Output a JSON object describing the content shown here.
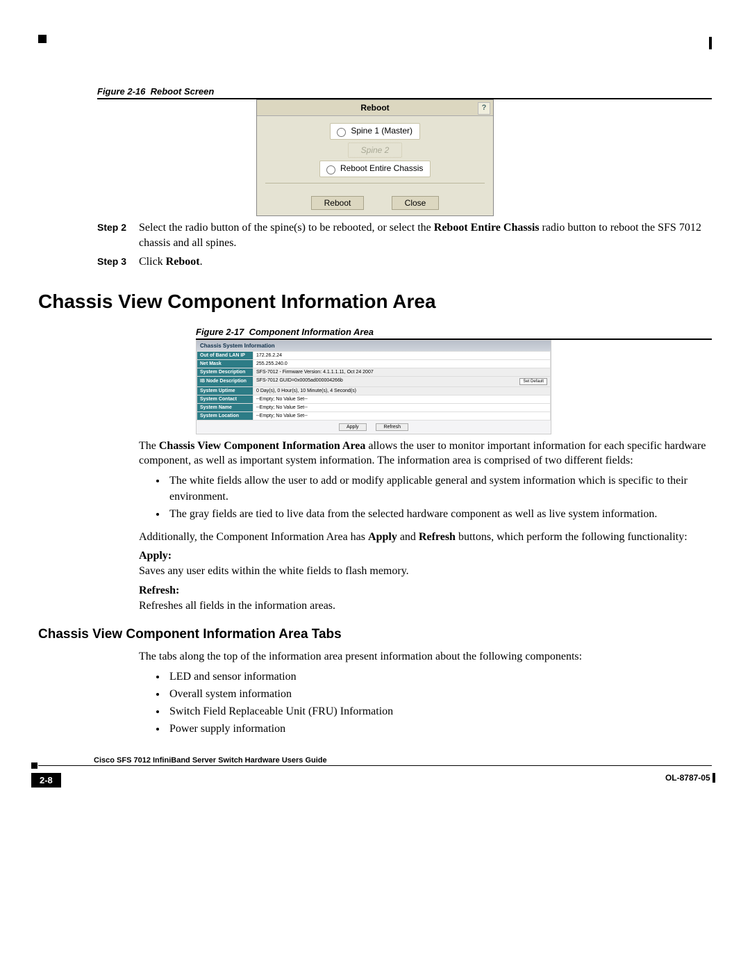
{
  "figures": {
    "f16": {
      "label": "Figure 2-16",
      "title": "Reboot Screen"
    },
    "f17": {
      "label": "Figure 2-17",
      "title": "Component Information Area"
    }
  },
  "reboot_dialog": {
    "title": "Reboot",
    "help": "?",
    "opt1": "Spine 1 (Master)",
    "opt2": "Spine 2",
    "opt3": "Reboot Entire Chassis",
    "btn_reboot": "Reboot",
    "btn_close": "Close"
  },
  "steps": {
    "s2_label": "Step 2",
    "s2_text_a": "Select the radio button of the spine(s) to be rebooted, or select the ",
    "s2_bold": "Reboot Entire Chassis",
    "s2_text_b": " radio button to reboot the SFS 7012 chassis and all spines.",
    "s3_label": "Step 3",
    "s3_text_a": "Click ",
    "s3_bold": "Reboot",
    "s3_text_b": "."
  },
  "headings": {
    "h1": "Chassis View Component Information Area",
    "h2": "Chassis View Component Information Area Tabs"
  },
  "chassis_panel": {
    "header": "Chassis System Information",
    "rows": [
      {
        "label": "Out of Band LAN IP",
        "value": "172.26.2.24",
        "white": true
      },
      {
        "label": "Net Mask",
        "value": "255.255.240.0",
        "white": true
      },
      {
        "label": "System Description",
        "value": "SFS-7012 - Firmware Version: 4.1.1.1.11, Oct 24 2007"
      },
      {
        "label": "IB Node Description",
        "value": "SFS-7012 GUID=0x0005ad000004266b",
        "set_btn": "Set Default"
      },
      {
        "label": "System Uptime",
        "value": "0 Day(s), 0 Hour(s), 10 Minute(s), 4 Second(s)"
      },
      {
        "label": "System Contact",
        "value": "--Empty; No Value Set--",
        "white": true
      },
      {
        "label": "System Name",
        "value": "--Empty; No Value Set--",
        "white": true
      },
      {
        "label": "System Location",
        "value": "--Empty; No Value Set--",
        "white": true
      }
    ],
    "btn_apply": "Apply",
    "btn_refresh": "Refresh"
  },
  "body": {
    "p1a": "The ",
    "p1b": "Chassis View Component Information Area",
    "p1c": " allows the user to monitor important information for each specific hardware component, as well as important system information. The information area is comprised of two different fields:",
    "bul_a": "The white fields allow the user to add or modify applicable general and system information which is specific to their environment.",
    "bul_b": "The gray fields are tied to live data from the selected hardware component as well as live system information.",
    "p2a": "Additionally, the Component Information Area has ",
    "p2b": "Apply",
    "p2c": " and ",
    "p2d": "Refresh",
    "p2e": " buttons, which perform the following functionality:",
    "apply_h": "Apply:",
    "apply_t": "Saves any user edits within the white fields to flash memory.",
    "refresh_h": "Refresh:",
    "refresh_t": "Refreshes all fields in the information areas.",
    "tabs_intro": "The tabs along the top of the information area present information about the following components:",
    "tabs": [
      "LED and sensor information",
      "Overall system information",
      "Switch Field Replaceable Unit (FRU) Information",
      "Power supply information"
    ]
  },
  "footer": {
    "book": "Cisco SFS 7012 InfiniBand Server Switch Hardware Users Guide",
    "page": "2-8",
    "doc": "OL-8787-05"
  }
}
